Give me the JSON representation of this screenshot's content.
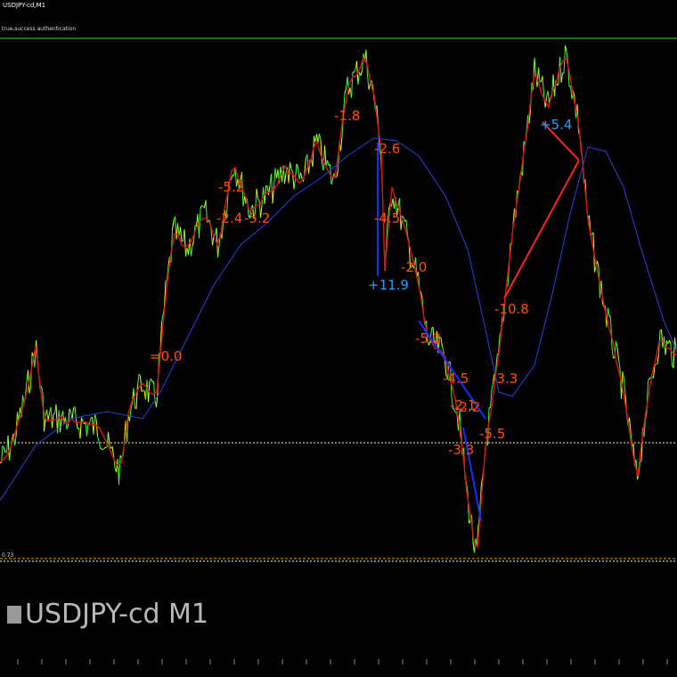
{
  "window": {
    "title": "USDJPY-cd,M1",
    "auth_message": "true,success authentication",
    "level_label": "0.73",
    "watermark": "USDJPY-cd M1"
  },
  "colors": {
    "background": "#000000",
    "price_line_green": "#33ff33",
    "price_line_yellow": "#ffff00",
    "fast_ma": "#dd1111",
    "slow_ma": "#2244dd",
    "swing_up": "#ff2020",
    "swing_down": "#1030ff",
    "label_red": "#ff5000",
    "label_blue": "#20a0ff",
    "hline_white": "#ffff99",
    "hline_orange": "#ff9900",
    "top_border": "#33cc33"
  },
  "annotations": [
    {
      "text": "-1.8"
    },
    {
      "text": "-2.6"
    },
    {
      "text": "-4.5"
    },
    {
      "text": "+11.9"
    },
    {
      "text": "-2.0"
    },
    {
      "text": "-5.2"
    },
    {
      "text": "-4.5"
    },
    {
      "text": "-2.1"
    },
    {
      "text": "-5.5"
    },
    {
      "text": "-3.3"
    },
    {
      "text": "-10.8"
    },
    {
      "text": "-3.3"
    },
    {
      "text": "+5.4"
    },
    {
      "text": "=0.0"
    },
    {
      "text": "-5.2"
    },
    {
      "text": "-2.4"
    },
    {
      "text": "-5.2"
    },
    {
      "text": "-2.2"
    }
  ],
  "time_ticks": [
    "",
    "",
    "",
    "",
    "",
    "",
    "",
    "",
    "",
    "",
    "",
    "",
    "",
    "",
    "",
    "",
    "",
    "",
    "",
    "",
    "",
    "",
    "",
    "",
    "",
    "",
    "",
    ""
  ]
}
